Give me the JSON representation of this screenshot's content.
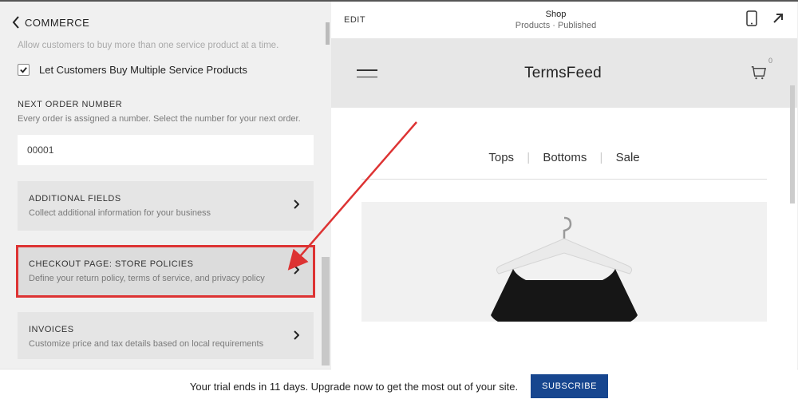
{
  "panel": {
    "title": "COMMERCE",
    "faded_line": "Allow customers to buy more than one service product at a time.",
    "checkbox_label": "Let Customers Buy Multiple Service Products",
    "next_order": {
      "title": "NEXT ORDER NUMBER",
      "desc": "Every order is assigned a number. Select the number for your next order.",
      "value": "00001"
    },
    "cards": {
      "additional": {
        "title": "ADDITIONAL FIELDS",
        "desc": "Collect additional information for your business"
      },
      "policies": {
        "title": "CHECKOUT PAGE: STORE POLICIES",
        "desc": "Define your return policy, terms of service, and privacy policy"
      },
      "invoices": {
        "title": "INVOICES",
        "desc": "Customize price and tax details based on local requirements"
      }
    }
  },
  "preview": {
    "edit": "EDIT",
    "header_title": "Shop",
    "header_sub": "Products · Published",
    "store_name": "TermsFeed",
    "cart_count": "0",
    "nav": {
      "tops": "Tops",
      "bottoms": "Bottoms",
      "sale": "Sale"
    }
  },
  "footer": {
    "trial": "Your trial ends in 11 days. Upgrade now to get the most out of your site.",
    "subscribe": "SUBSCRIBE"
  }
}
